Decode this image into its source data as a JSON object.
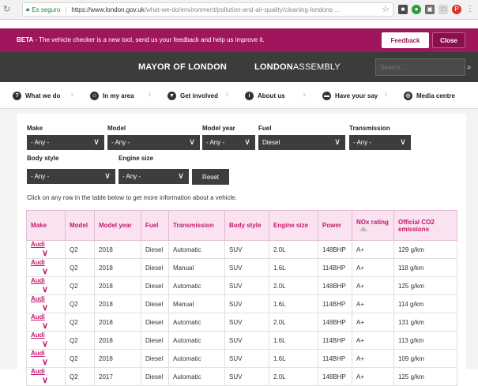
{
  "browser": {
    "secure_label": "Es seguro",
    "url_host": "https://www.london.gov.uk",
    "url_path": "/what-we-do/environment/pollution-and-air-quality/cleaning-londons-..."
  },
  "beta": {
    "tag": "BETA",
    "message": " - The vehicle checker is a new tool, send us your feedback and help us improve it.",
    "feedback_label": "Feedback",
    "close_label": "Close"
  },
  "header": {
    "mayor": "MAYOR OF LONDON",
    "assembly_bold": "LONDON",
    "assembly_rest": "ASSEMBLY",
    "search_placeholder": "Search..."
  },
  "nav": [
    {
      "label": "What we do",
      "icon": "question-icon"
    },
    {
      "label": "In my area",
      "icon": "person-icon"
    },
    {
      "label": "Get involved",
      "icon": "location-pin-icon"
    },
    {
      "label": "About us",
      "icon": "info-icon"
    },
    {
      "label": "Have your say",
      "icon": "speech-bubble-icon"
    },
    {
      "label": "Media centre",
      "icon": "globe-icon"
    }
  ],
  "filters": {
    "make": {
      "label": "Make",
      "value": "- Any -"
    },
    "model": {
      "label": "Model",
      "value": "- Any -"
    },
    "model_year": {
      "label": "Model year",
      "value": "- Any -"
    },
    "fuel": {
      "label": "Fuel",
      "value": "Diesel"
    },
    "transmission": {
      "label": "Transmission",
      "value": "- Any -"
    },
    "body_style": {
      "label": "Body style",
      "value": "- Any -"
    },
    "engine_size": {
      "label": "Engine size",
      "value": "- Any -"
    },
    "reset_label": "Reset"
  },
  "hint": "Click on any row in the table below to get more information about a vehicle.",
  "table": {
    "headers": [
      "Make",
      "Model",
      "Model year",
      "Fuel",
      "Transmission",
      "Body style",
      "Engine size",
      "Power",
      "NOx rating",
      "Official CO2 emissions"
    ],
    "rows": [
      [
        "Audi",
        "Q2",
        "2018",
        "Diesel",
        "Automatic",
        "SUV",
        "2.0L",
        "148BHP",
        "A+",
        "129 g/km"
      ],
      [
        "Audi",
        "Q2",
        "2018",
        "Diesel",
        "Manual",
        "SUV",
        "1.6L",
        "114BHP",
        "A+",
        "118 g/km"
      ],
      [
        "Audi",
        "Q2",
        "2018",
        "Diesel",
        "Automatic",
        "SUV",
        "2.0L",
        "148BHP",
        "A+",
        "125 g/km"
      ],
      [
        "Audi",
        "Q2",
        "2018",
        "Diesel",
        "Manual",
        "SUV",
        "1.6L",
        "114BHP",
        "A+",
        "114 g/km"
      ],
      [
        "Audi",
        "Q2",
        "2018",
        "Diesel",
        "Automatic",
        "SUV",
        "2.0L",
        "148BHP",
        "A+",
        "131 g/km"
      ],
      [
        "Audi",
        "Q2",
        "2018",
        "Diesel",
        "Automatic",
        "SUV",
        "1.6L",
        "114BHP",
        "A+",
        "113 g/km"
      ],
      [
        "Audi",
        "Q2",
        "2018",
        "Diesel",
        "Automatic",
        "SUV",
        "1.6L",
        "114BHP",
        "A+",
        "109 g/km"
      ],
      [
        "Audi",
        "Q2",
        "2017",
        "Diesel",
        "Automatic",
        "SUV",
        "2.0L",
        "148BHP",
        "A+",
        "125 g/km"
      ]
    ]
  },
  "colors": {
    "brand": "#a0165d",
    "header_bg": "#3c3c3c",
    "table_header_bg": "#fbe2f0",
    "accent_text": "#c01a6e"
  }
}
